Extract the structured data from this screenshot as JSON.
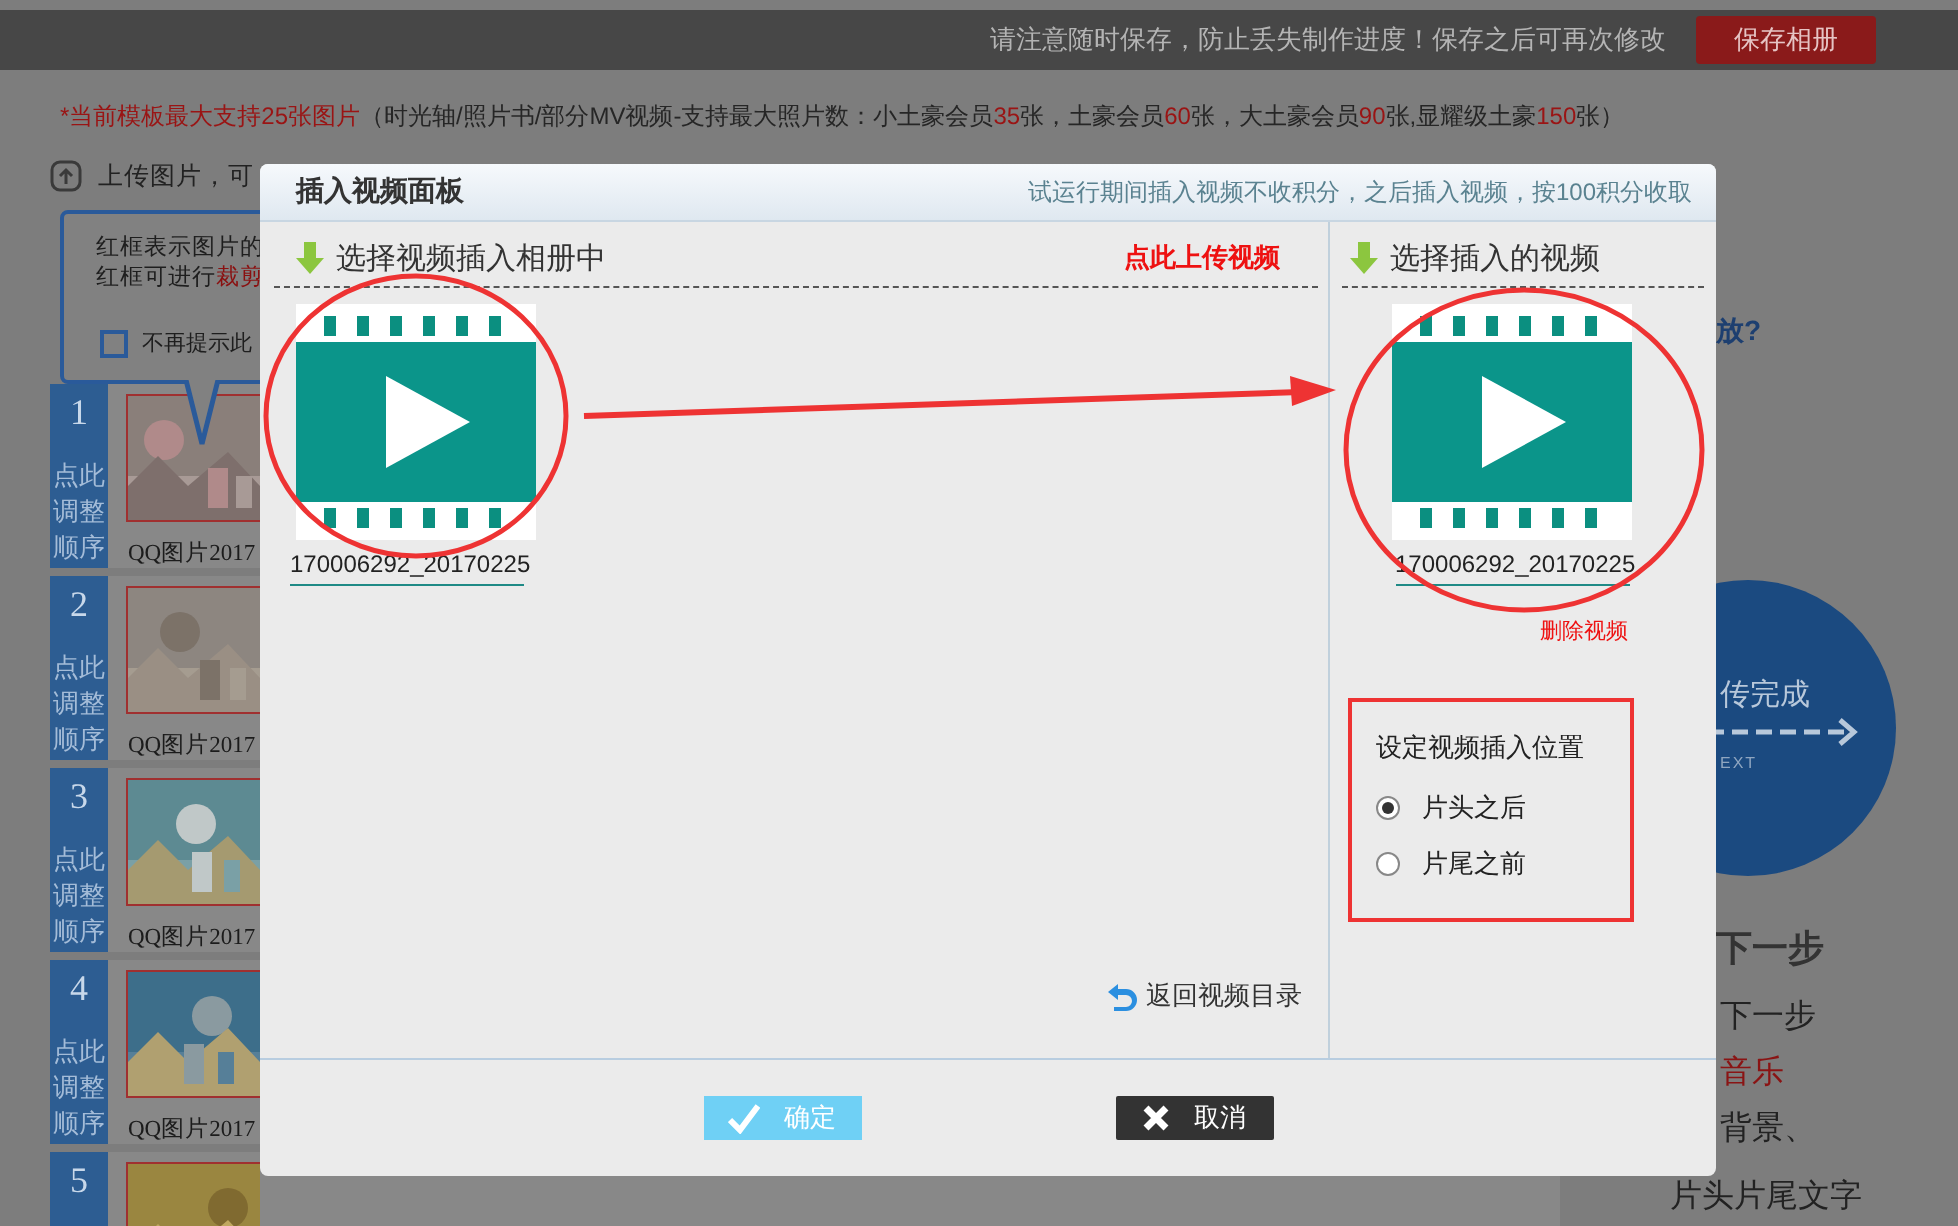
{
  "top_bar": {
    "notice": "请注意随时保存，防止丢失制作进度！保存之后可再次修改",
    "save_button": "保存相册"
  },
  "limit_notice": {
    "parts": [
      {
        "text": "*当前模板最大支持25张图片",
        "highlight": true
      },
      {
        "text": "（时光轴/照片书/部分MV视频-支持最大照片数：小土豪会员",
        "highlight": false
      },
      {
        "text": "35",
        "highlight": true
      },
      {
        "text": "张，土豪会员",
        "highlight": false
      },
      {
        "text": "60",
        "highlight": true
      },
      {
        "text": "张，大土豪会员",
        "highlight": false
      },
      {
        "text": "90",
        "highlight": true
      },
      {
        "text": "张,显耀级土豪",
        "highlight": false
      },
      {
        "text": "150",
        "highlight": true
      },
      {
        "text": "张）",
        "highlight": false
      }
    ]
  },
  "upload_hint": "上传图片，可",
  "tooltip": {
    "lines": [
      [
        {
          "text": "红框表示图片的",
          "highlight": false
        }
      ],
      [
        {
          "text": "红框可进行",
          "highlight": false
        },
        {
          "text": "裁剪",
          "highlight": true
        }
      ]
    ],
    "checkbox": {
      "label": "不再提示此",
      "checked": false
    }
  },
  "photos": [
    {
      "number": "1",
      "handle": "点此调整顺序",
      "caption": "QQ图片2017"
    },
    {
      "number": "2",
      "handle": "点此调整顺序",
      "caption": "QQ图片2017"
    },
    {
      "number": "3",
      "handle": "点此调整顺序",
      "caption": "QQ图片2017"
    },
    {
      "number": "4",
      "handle": "点此调整顺序",
      "caption": "QQ图片2017"
    },
    {
      "number": "5"
    }
  ],
  "right_side": {
    "help_link": "放?",
    "next_circle": {
      "title": "传完成",
      "subtitle": "EXT"
    },
    "next_step": {
      "heading": "下一步",
      "lines": [
        {
          "text": "下一步",
          "highlight": false
        },
        {
          "text": "音乐",
          "highlight": true
        },
        {
          "text": "背景、",
          "highlight": false
        },
        {
          "text": "片头片尾文字",
          "highlight": false
        }
      ]
    }
  },
  "modal": {
    "title": "插入视频面板",
    "notice": "试运行期间插入视频不收积分，之后插入视频，按100积分收取",
    "library": {
      "heading": "选择视频插入相册中",
      "upload_link": "点此上传视频",
      "videos": [
        {
          "caption": "170006292_20170225"
        }
      ],
      "back_link": "返回视频目录"
    },
    "chosen": {
      "heading": "选择插入的视频",
      "video": {
        "caption": "170006292_20170225"
      },
      "delete_link": "删除视频",
      "position": {
        "title": "设定视频插入位置",
        "options": [
          {
            "label": "片头之后",
            "selected": true
          },
          {
            "label": "片尾之前",
            "selected": false
          }
        ]
      }
    },
    "buttons": [
      {
        "label": "确定",
        "kind": "confirm"
      },
      {
        "label": "取消",
        "kind": "cancel"
      }
    ]
  }
}
